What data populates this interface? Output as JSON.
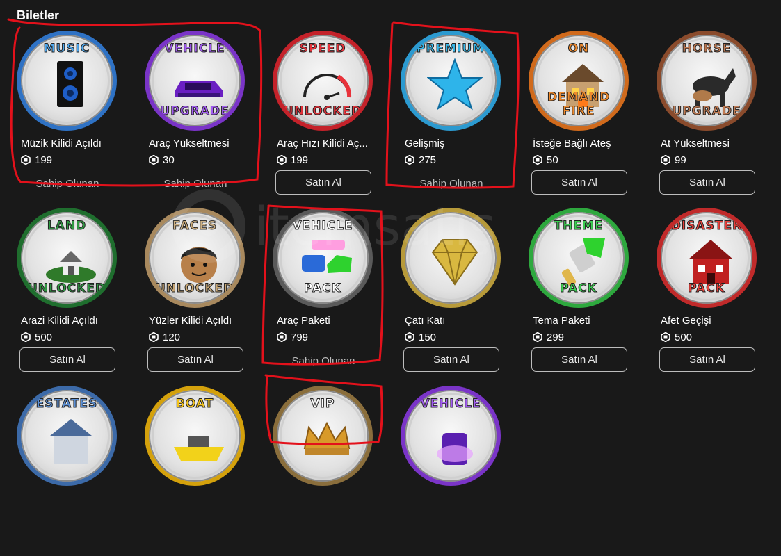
{
  "section": {
    "title": "Biletler"
  },
  "items": [
    {
      "name": "Müzik Kilidi Açıldı",
      "price": "199",
      "status": "owned",
      "status_label": "Sahip Olunan",
      "badge_top": "MUSIC",
      "badge_bottom": "",
      "rim_color": "#2f72c4",
      "top_color": "#4fa9f0",
      "bottom_color": "#4fa9f0",
      "art": "speaker"
    },
    {
      "name": "Araç Yükseltmesi",
      "price": "30",
      "status": "owned",
      "status_label": "Sahip Olunan",
      "badge_top": "VEHICLE",
      "badge_bottom": "UPGRADE",
      "rim_color": "#7a34c7",
      "top_color": "#a25cf0",
      "bottom_color": "#a25cf0",
      "art": "car"
    },
    {
      "name": "Araç Hızı Kilidi Aç...",
      "price": "199",
      "status": "buy",
      "status_label": "Satın Al",
      "badge_top": "SPEED",
      "badge_bottom": "UNLOCKED",
      "rim_color": "#c4222a",
      "top_color": "#e8323a",
      "bottom_color": "#e8323a",
      "art": "speedometer"
    },
    {
      "name": "Gelişmiş",
      "price": "275",
      "status": "owned",
      "status_label": "Sahip Olunan",
      "badge_top": "PREMIUM",
      "badge_bottom": "",
      "rim_color": "#2c9ad0",
      "top_color": "#38b8ea",
      "bottom_color": "#38b8ea",
      "art": "star"
    },
    {
      "name": "İsteğe Bağlı Ateş",
      "price": "50",
      "status": "buy",
      "status_label": "Satın Al",
      "badge_top": "ON",
      "badge_bottom": "DEMAND FIRE",
      "rim_color": "#d06a1c",
      "top_color": "#f08a2c",
      "bottom_color": "#f08a2c",
      "art": "house-fire"
    },
    {
      "name": "At Yükseltmesi",
      "price": "99",
      "status": "buy",
      "status_label": "Satın Al",
      "badge_top": "HORSE",
      "badge_bottom": "UPGRADE",
      "rim_color": "#8a4b2c",
      "top_color": "#c07a52",
      "bottom_color": "#c07a52",
      "art": "horse"
    },
    {
      "name": "Arazi Kilidi Açıldı",
      "price": "500",
      "status": "buy",
      "status_label": "Satın Al",
      "badge_top": "LAND",
      "badge_bottom": "UNLOCKED",
      "rim_color": "#1f6e2e",
      "top_color": "#2f9a42",
      "bottom_color": "#2f9a42",
      "art": "land"
    },
    {
      "name": "Yüzler Kilidi Açıldı",
      "price": "120",
      "status": "buy",
      "status_label": "Satın Al",
      "badge_top": "FACES",
      "badge_bottom": "UNLOCKED",
      "rim_color": "#a8895e",
      "top_color": "#c9a876",
      "bottom_color": "#c9a876",
      "art": "face"
    },
    {
      "name": "Araç Paketi",
      "price": "799",
      "status": "owned",
      "status_label": "Sahip Olunan",
      "badge_top": "VEHICLE",
      "badge_bottom": "PACK",
      "rim_color": "#5a5a5a",
      "top_color": "#ffffff",
      "bottom_color": "#ffffff",
      "art": "cars"
    },
    {
      "name": "Çatı Katı",
      "price": "150",
      "status": "buy",
      "status_label": "Satın Al",
      "badge_top": "",
      "badge_bottom": "",
      "rim_color": "#b79a3a",
      "top_color": "#ffffff",
      "bottom_color": "#ffffff",
      "art": "diamond"
    },
    {
      "name": "Tema Paketi",
      "price": "299",
      "status": "buy",
      "status_label": "Satın Al",
      "badge_top": "THEME",
      "badge_bottom": "PACK",
      "rim_color": "#2ea83e",
      "top_color": "#3ccf52",
      "bottom_color": "#3ccf52",
      "art": "brush"
    },
    {
      "name": "Afet Geçişi",
      "price": "500",
      "status": "buy",
      "status_label": "Satın Al",
      "badge_top": "DISASTER",
      "badge_bottom": "PACK",
      "rim_color": "#c02a2a",
      "top_color": "#e8403a",
      "bottom_color": "#e8403a",
      "art": "disaster"
    },
    {
      "name": "",
      "price": "",
      "status": "none",
      "status_label": "",
      "badge_top": "ESTATES",
      "badge_bottom": "",
      "rim_color": "#3c6aa8",
      "top_color": "#5b8fd4",
      "bottom_color": "#5b8fd4",
      "art": "estate"
    },
    {
      "name": "",
      "price": "",
      "status": "none",
      "status_label": "",
      "badge_top": "BOAT",
      "badge_bottom": "",
      "rim_color": "#d4a10c",
      "top_color": "#f2c21a",
      "bottom_color": "#f2c21a",
      "art": "boat"
    },
    {
      "name": "",
      "price": "",
      "status": "none",
      "status_label": "",
      "badge_top": "VIP",
      "badge_bottom": "",
      "rim_color": "#8a6e3c",
      "top_color": "#ffffff",
      "bottom_color": "#ffffff",
      "art": "crown"
    },
    {
      "name": "",
      "price": "",
      "status": "none",
      "status_label": "",
      "badge_top": "VEHICLE",
      "badge_bottom": "",
      "rim_color": "#7a34c7",
      "top_color": "#a25cf0",
      "bottom_color": "#a25cf0",
      "art": "car-neon"
    }
  ],
  "colors": {
    "background": "#191919",
    "annotation": "#e3111b",
    "button_border": "#bdbdbd"
  },
  "watermark": {
    "text": "itemsatış"
  }
}
